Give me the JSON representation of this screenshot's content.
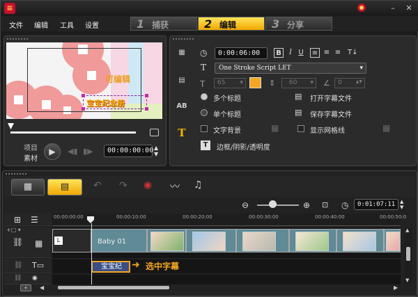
{
  "menu": [
    "文件",
    "编辑",
    "工具",
    "设置"
  ],
  "steps": [
    {
      "num": "1",
      "label": "捕获",
      "active": false
    },
    {
      "num": "2",
      "label": "编辑",
      "active": true
    },
    {
      "num": "3",
      "label": "分享",
      "active": false
    }
  ],
  "window": {
    "minimize": "–",
    "close": "✕"
  },
  "player": {
    "project_label": "项目",
    "clip_label": "素材",
    "timecode": "00:00:00:00",
    "overlay_text": "可编辑",
    "title_text": "宝宝纪念册"
  },
  "options": {
    "duration": "0:00:06:00",
    "bold": "B",
    "italic": "I",
    "underline": "U",
    "font": "One Stroke Script LET",
    "font_size": "65",
    "line_spacing": "60",
    "angle": "0",
    "multi_title": "多个标题",
    "single_title": "单个标题",
    "open_subtitle": "打开字幕文件",
    "save_subtitle": "保存字幕文件",
    "text_bg": "文字背景",
    "show_grid": "显示网格线",
    "border_shadow": "边框/阴影/透明度",
    "accent": "#f5a623"
  },
  "timeline": {
    "ruler": [
      "00:00:00:00",
      "00:00:10:00",
      "00:00:20:00",
      "00:00:30:00",
      "00:00:40:00",
      "00:00:50:0"
    ],
    "project_duration": "0:01:07:11",
    "clip_name": "Baby 01",
    "title_clip": "宝宝纪",
    "annotation": "选中字幕"
  }
}
